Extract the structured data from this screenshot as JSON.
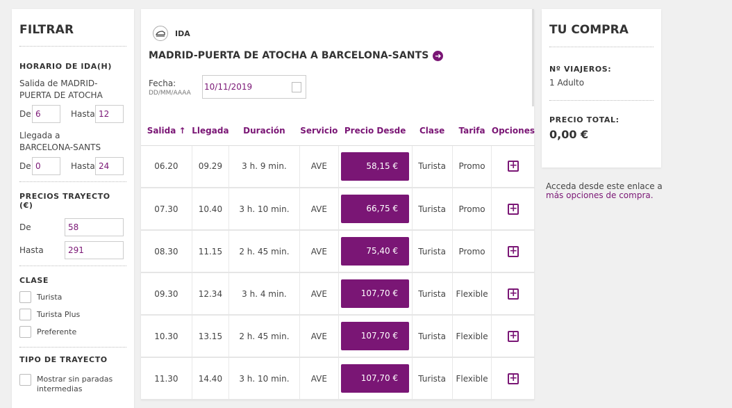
{
  "filter": {
    "title": "FILTRAR",
    "horario_title": "HORARIO DE IDA(H)",
    "salida_label": "Salida de MADRID-PUERTA DE ATOCHA",
    "salida_de_label": "De",
    "salida_de_value": "6",
    "salida_hasta_label": "Hasta",
    "salida_hasta_value": "12",
    "llegada_label": "Llegada a BARCELONA-SANTS",
    "llegada_de_label": "De",
    "llegada_de_value": "0",
    "llegada_hasta_label": "Hasta",
    "llegada_hasta_value": "24",
    "precios_title": "PRECIOS TRAYECTO (€)",
    "precio_de_label": "De",
    "precio_de_value": "58",
    "precio_hasta_label": "Hasta",
    "precio_hasta_value": "291",
    "clase_title": "CLASE",
    "clases": [
      "Turista",
      "Turista Plus",
      "Preferente"
    ],
    "tipo_title": "TIPO DE TRAYECTO",
    "tipo_option": "Mostrar sin paradas intermedias"
  },
  "main": {
    "direction": "IDA",
    "route": "MADRID-PUERTA DE ATOCHA A BARCELONA-SANTS",
    "fecha_label": "Fecha:",
    "fecha_format": "DD/MM/AAAA",
    "fecha_value": "10/11/2019",
    "columns": [
      "Salida ↑",
      "Llegada",
      "Duración",
      "Servicio",
      "Precio Desde",
      "Clase",
      "Tarifa",
      "Opciones"
    ],
    "rows": [
      {
        "salida": "06.20",
        "llegada": "09.29",
        "duracion": "3 h. 9 min.",
        "servicio": "AVE",
        "precio": "58,15 €",
        "clase": "Turista",
        "tarifa": "Promo"
      },
      {
        "salida": "07.30",
        "llegada": "10.40",
        "duracion": "3 h. 10 min.",
        "servicio": "AVE",
        "precio": "66,75 €",
        "clase": "Turista",
        "tarifa": "Promo"
      },
      {
        "salida": "08.30",
        "llegada": "11.15",
        "duracion": "2 h. 45 min.",
        "servicio": "AVE",
        "precio": "75,40 €",
        "clase": "Turista",
        "tarifa": "Promo"
      },
      {
        "salida": "09.30",
        "llegada": "12.34",
        "duracion": "3 h. 4 min.",
        "servicio": "AVE",
        "precio": "107,70 €",
        "clase": "Turista",
        "tarifa": "Flexible"
      },
      {
        "salida": "10.30",
        "llegada": "13.15",
        "duracion": "2 h. 45 min.",
        "servicio": "AVE",
        "precio": "107,70 €",
        "clase": "Turista",
        "tarifa": "Flexible"
      },
      {
        "salida": "11.30",
        "llegada": "14.40",
        "duracion": "3 h. 10 min.",
        "servicio": "AVE",
        "precio": "107,70 €",
        "clase": "Turista",
        "tarifa": "Flexible"
      }
    ]
  },
  "purchase": {
    "title": "TU COMPRA",
    "viajeros_label": "Nº VIAJEROS:",
    "viajeros_value": "1 Adulto",
    "total_label": "PRECIO TOTAL:",
    "total_value": "0,00 €",
    "note_text": "Acceda desde este enlace a",
    "note_link": "más opciones de compra."
  },
  "colors": {
    "accent": "#7a1675"
  }
}
